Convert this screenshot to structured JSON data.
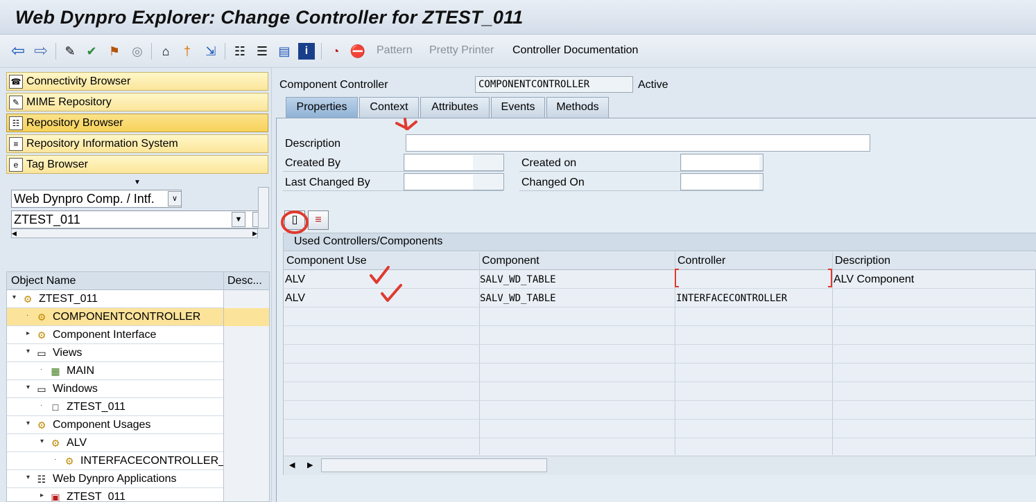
{
  "window": {
    "title": "Web Dynpro Explorer: Change Controller for ZTEST_011"
  },
  "toolbar": {
    "pattern_label": "Pattern",
    "pretty_printer_label": "Pretty Printer",
    "controller_doc_label": "Controller Documentation"
  },
  "nav_buttons": [
    {
      "label": "Connectivity Browser"
    },
    {
      "label": "MIME Repository"
    },
    {
      "label": "Repository Browser"
    },
    {
      "label": "Repository Information System"
    },
    {
      "label": "Tag Browser"
    }
  ],
  "object_selector": {
    "type_value": "Web Dynpro Comp. / Intf.",
    "name_value": "ZTEST_011"
  },
  "tree": {
    "col_object_name": "Object Name",
    "col_description": "Desc...",
    "rows": [
      {
        "label": "ZTEST_011"
      },
      {
        "label": "COMPONENTCONTROLLER"
      },
      {
        "label": "Component Interface"
      },
      {
        "label": "Views"
      },
      {
        "label": "MAIN"
      },
      {
        "label": "Windows"
      },
      {
        "label": "ZTEST_011"
      },
      {
        "label": "Component Usages"
      },
      {
        "label": "ALV"
      },
      {
        "label": "INTERFACECONTROLLER_"
      },
      {
        "label": "Web Dynpro Applications"
      },
      {
        "label": "ZTEST_011"
      }
    ]
  },
  "controller": {
    "label": "Component Controller",
    "name": "COMPONENTCONTROLLER",
    "status": "Active"
  },
  "tabs": [
    {
      "label": "Properties"
    },
    {
      "label": "Context"
    },
    {
      "label": "Attributes"
    },
    {
      "label": "Events"
    },
    {
      "label": "Methods"
    }
  ],
  "properties": {
    "description_label": "Description",
    "description_value": "",
    "created_by_label": "Created By",
    "created_on_label": "Created on",
    "last_changed_by_label": "Last Changed By",
    "changed_on_label": "Changed On"
  },
  "used_controllers": {
    "title": "Used Controllers/Components",
    "columns": [
      "Component Use",
      "Component",
      "Controller",
      "Description"
    ],
    "rows": [
      {
        "component_use": "ALV",
        "component": "SALV_WD_TABLE",
        "controller": "",
        "description": "ALV Component"
      },
      {
        "component_use": "ALV",
        "component": "SALV_WD_TABLE",
        "controller": "INTERFACECONTROLLER",
        "description": ""
      }
    ]
  },
  "colors": {
    "selection": "#fbe39a",
    "annotation": "#e03a2f",
    "active_tab": "#8fb1d4"
  }
}
